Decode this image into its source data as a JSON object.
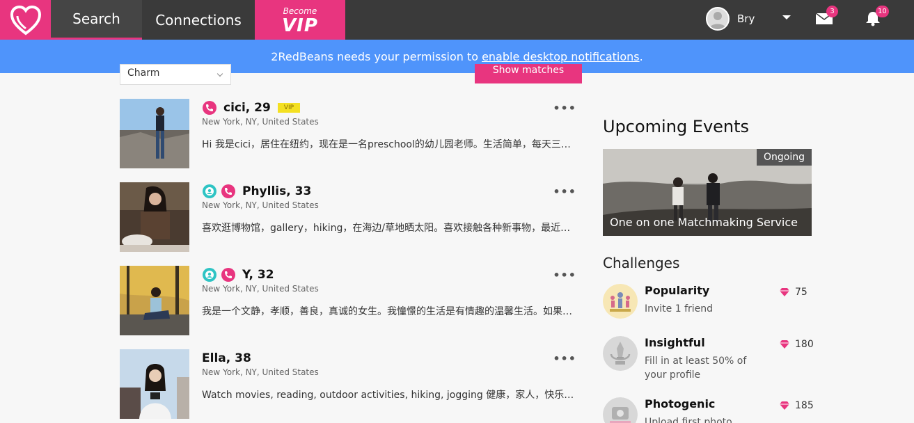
{
  "nav": {
    "search": "Search",
    "connections": "Connections",
    "vip_small": "Become",
    "vip_big": "VIP",
    "username": "Bry",
    "mail_count": "3",
    "bell_count": "10"
  },
  "notification": {
    "text": "2RedBeans needs your permission to",
    "link": "enable desktop notifications",
    "suffix": "."
  },
  "filter": {
    "sort_value": "Charm",
    "show_matches": "Show matches"
  },
  "profiles": [
    {
      "name": "cici, 29",
      "vip": "VIP",
      "location": "New York, NY, United States",
      "bio": "Hi 我是cici，居住在纽约，现在是一名preschool的幼儿园老师。生活简单，每天三点…"
    },
    {
      "name": "Phyllis, 33",
      "location": "New York, NY, United States",
      "bio": "喜欢逛博物馆，gallery，hiking，在海边/草地晒太阳。喜欢接触各种新事物，最近在…"
    },
    {
      "name": "Y, 32",
      "location": "New York, NY, United States",
      "bio": "我是一个文静，孝顺，善良，真诚的女生。我憧憬的生活是有情趣的温馨生活。如果只…"
    },
    {
      "name": "Ella, 38",
      "location": "New York, NY, United States",
      "bio": "Watch movies, reading, outdoor activities, hiking, jogging 健康，家人，快乐，朋友…"
    }
  ],
  "events": {
    "title": "Upcoming Events",
    "status": "Ongoing",
    "name": "One on one Matchmaking Service"
  },
  "challenges": {
    "title": "Challenges",
    "items": [
      {
        "name": "Popularity",
        "desc": "Invite 1 friend",
        "points": "75"
      },
      {
        "name": "Insightful",
        "desc": "Fill in at least 50% of your profile",
        "points": "180"
      },
      {
        "name": "Photogenic",
        "desc": "Upload first photo",
        "points": "185"
      }
    ]
  },
  "colors": {
    "brand": "#e8357f",
    "nav": "#3a3a3a",
    "notify": "#4f94fb",
    "vip_tag": "#f4e022"
  }
}
